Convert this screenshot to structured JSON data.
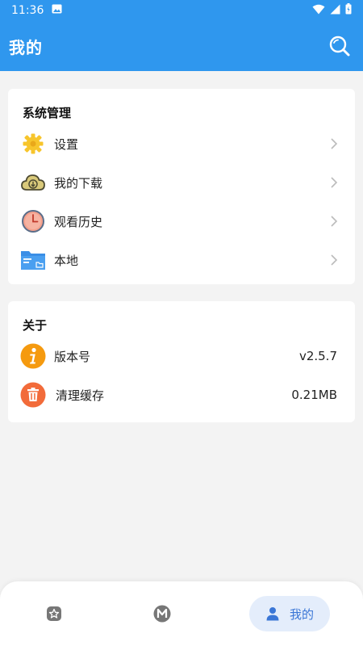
{
  "status_bar": {
    "time": "11:36"
  },
  "app_bar": {
    "title": "我的"
  },
  "system_section": {
    "title": "系统管理",
    "items": [
      {
        "label": "设置",
        "icon": "gear-icon"
      },
      {
        "label": "我的下载",
        "icon": "cloud-download-icon"
      },
      {
        "label": "观看历史",
        "icon": "clock-icon"
      },
      {
        "label": "本地",
        "icon": "folder-icon"
      }
    ]
  },
  "about_section": {
    "title": "关于",
    "items": [
      {
        "label": "版本号",
        "value": "v2.5.7",
        "icon": "info-icon"
      },
      {
        "label": "清理缓存",
        "value": "0.21MB",
        "icon": "trash-icon"
      }
    ]
  },
  "bottom_nav": {
    "items": [
      {
        "icon": "star-icon"
      },
      {
        "icon": "m-icon"
      },
      {
        "label": "我的",
        "icon": "person-icon"
      }
    ]
  },
  "colors": {
    "primary": "#2f97ee",
    "background": "#f3f3f3",
    "nav_active_bg": "#e4edfb",
    "nav_active_text": "#3a76d6"
  }
}
